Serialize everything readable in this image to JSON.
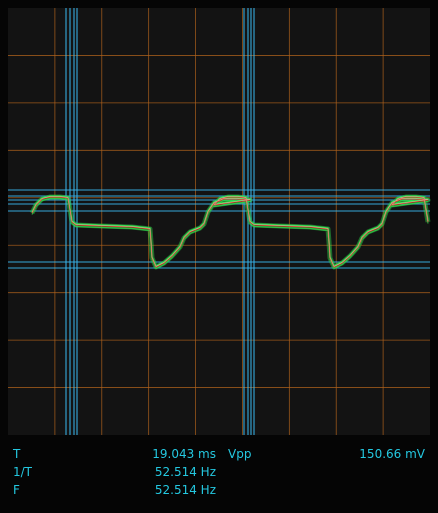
{
  "scope": {
    "colors": {
      "background": "#131313",
      "grid": "#b0621c",
      "cursor": "#38b8f0",
      "trace_green": "#2fd64a",
      "trace_red": "#d72a1e",
      "trace_white": "#e8f0d8"
    },
    "divisions": {
      "x": 9,
      "y": 9
    }
  },
  "measurements": {
    "period": {
      "label": "T",
      "value": "19.043 ms"
    },
    "vpp": {
      "label": "Vpp",
      "value": "150.66 mV"
    },
    "inverse_period": {
      "label": "1/T",
      "value": "52.514 Hz"
    },
    "frequency": {
      "label": "F",
      "value": "52.514 Hz"
    }
  }
}
